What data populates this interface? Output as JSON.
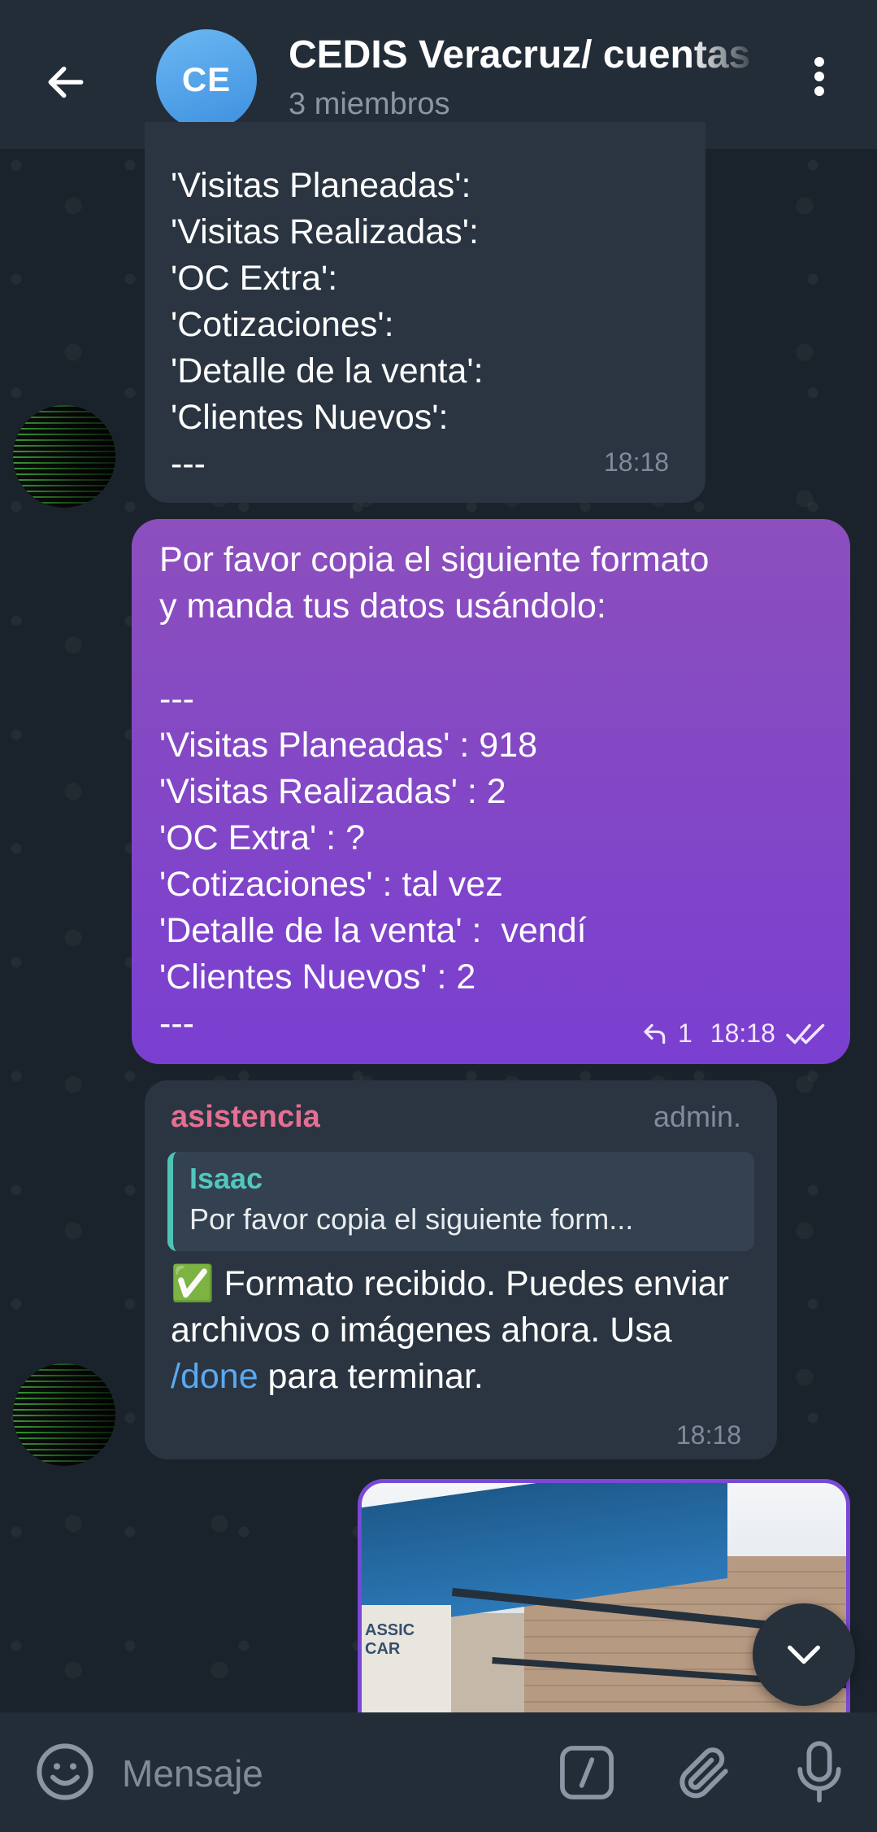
{
  "header": {
    "avatar_initials": "CE",
    "title": "CEDIS Veracruz/ cuentas",
    "subtitle": "3 miembros",
    "back_icon": "arrow-left-icon",
    "menu_icon": "more-vertical-icon"
  },
  "messages": {
    "first": {
      "text": "'Visitas Planeadas':\n'Visitas Realizadas':\n'OC Extra':\n'Cotizaciones':\n'Detalle de la venta':\n'Clientes Nuevos':\n---",
      "time": "18:18"
    },
    "outgoing": {
      "text": "Por favor copia el siguiente formato\ny manda tus datos usándolo:\n\n---\n'Visitas Planeadas' : 918\n'Visitas Realizadas' : 2\n'OC Extra' : ?\n'Cotizaciones' : tal vez\n'Detalle de la venta' :  vendí\n'Clientes Nuevos' : 2\n---",
      "replies": "1",
      "time": "18:18",
      "status_icon": "double-check-icon"
    },
    "bot_reply": {
      "sender": "asistencia",
      "role": "admin.",
      "quote_author": "Isaac",
      "quote_text": "Por favor copia el siguiente form...",
      "emoji": "✅",
      "text_before": " Formato recibido. Puedes enviar archivos o imágenes ahora. Usa ",
      "command": "/done",
      "text_after": " para terminar.",
      "time": "18:18"
    },
    "photo": {
      "sign_text": "ASSIC CAR"
    }
  },
  "input": {
    "placeholder": "Mensaje",
    "emoji_icon": "smiley-icon",
    "command_icon": "slash-command-icon",
    "attach_icon": "paperclip-icon",
    "mic_icon": "microphone-icon"
  },
  "colors": {
    "header_bg": "#232d38",
    "incoming_bubble": "#2a3541",
    "outgoing_bubble_top": "#8c4fbd",
    "outgoing_bubble_bottom": "#7a3fd0",
    "sender_name": "#e46f93",
    "quote_accent": "#4fc3b8",
    "link": "#5aa9f0"
  }
}
